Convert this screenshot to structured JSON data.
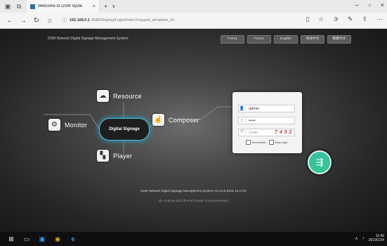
{
  "browser": {
    "tab_title": "Welcome to DSM Syste",
    "tab_close": "×",
    "new_tab": "+",
    "tab_dropdown": "∨",
    "window_controls": [
      "–",
      "▫",
      "×"
    ],
    "url_host": "192.168.0.1",
    "url_path": ":8080/Display/Login/Index?request_id=admin_01"
  },
  "page": {
    "system_title": "DSM Network Digital Signage Management System",
    "top_buttons": [
      "Form1",
      "Form2",
      "English",
      "简体中文",
      "繁體中文"
    ],
    "nodes": {
      "resource": "Resource",
      "monitor": "Monitor",
      "composer": "Composer",
      "player": "Player",
      "center": "Digital Signage"
    },
    "login": {
      "username": "admin",
      "password": "•••••",
      "code_placeholder": "Code",
      "captcha": "7 4 5 2",
      "remember_label": "Remember",
      "autologin_label": "Auto login"
    },
    "version_text": "DSM Network Digital Signage Management System V1.0.6.0 B101.16.1719",
    "note_text": "(IE or above and Chrome browser is recommended)"
  },
  "taskbar": {
    "time": "11:40",
    "date": "2019/12/4"
  }
}
